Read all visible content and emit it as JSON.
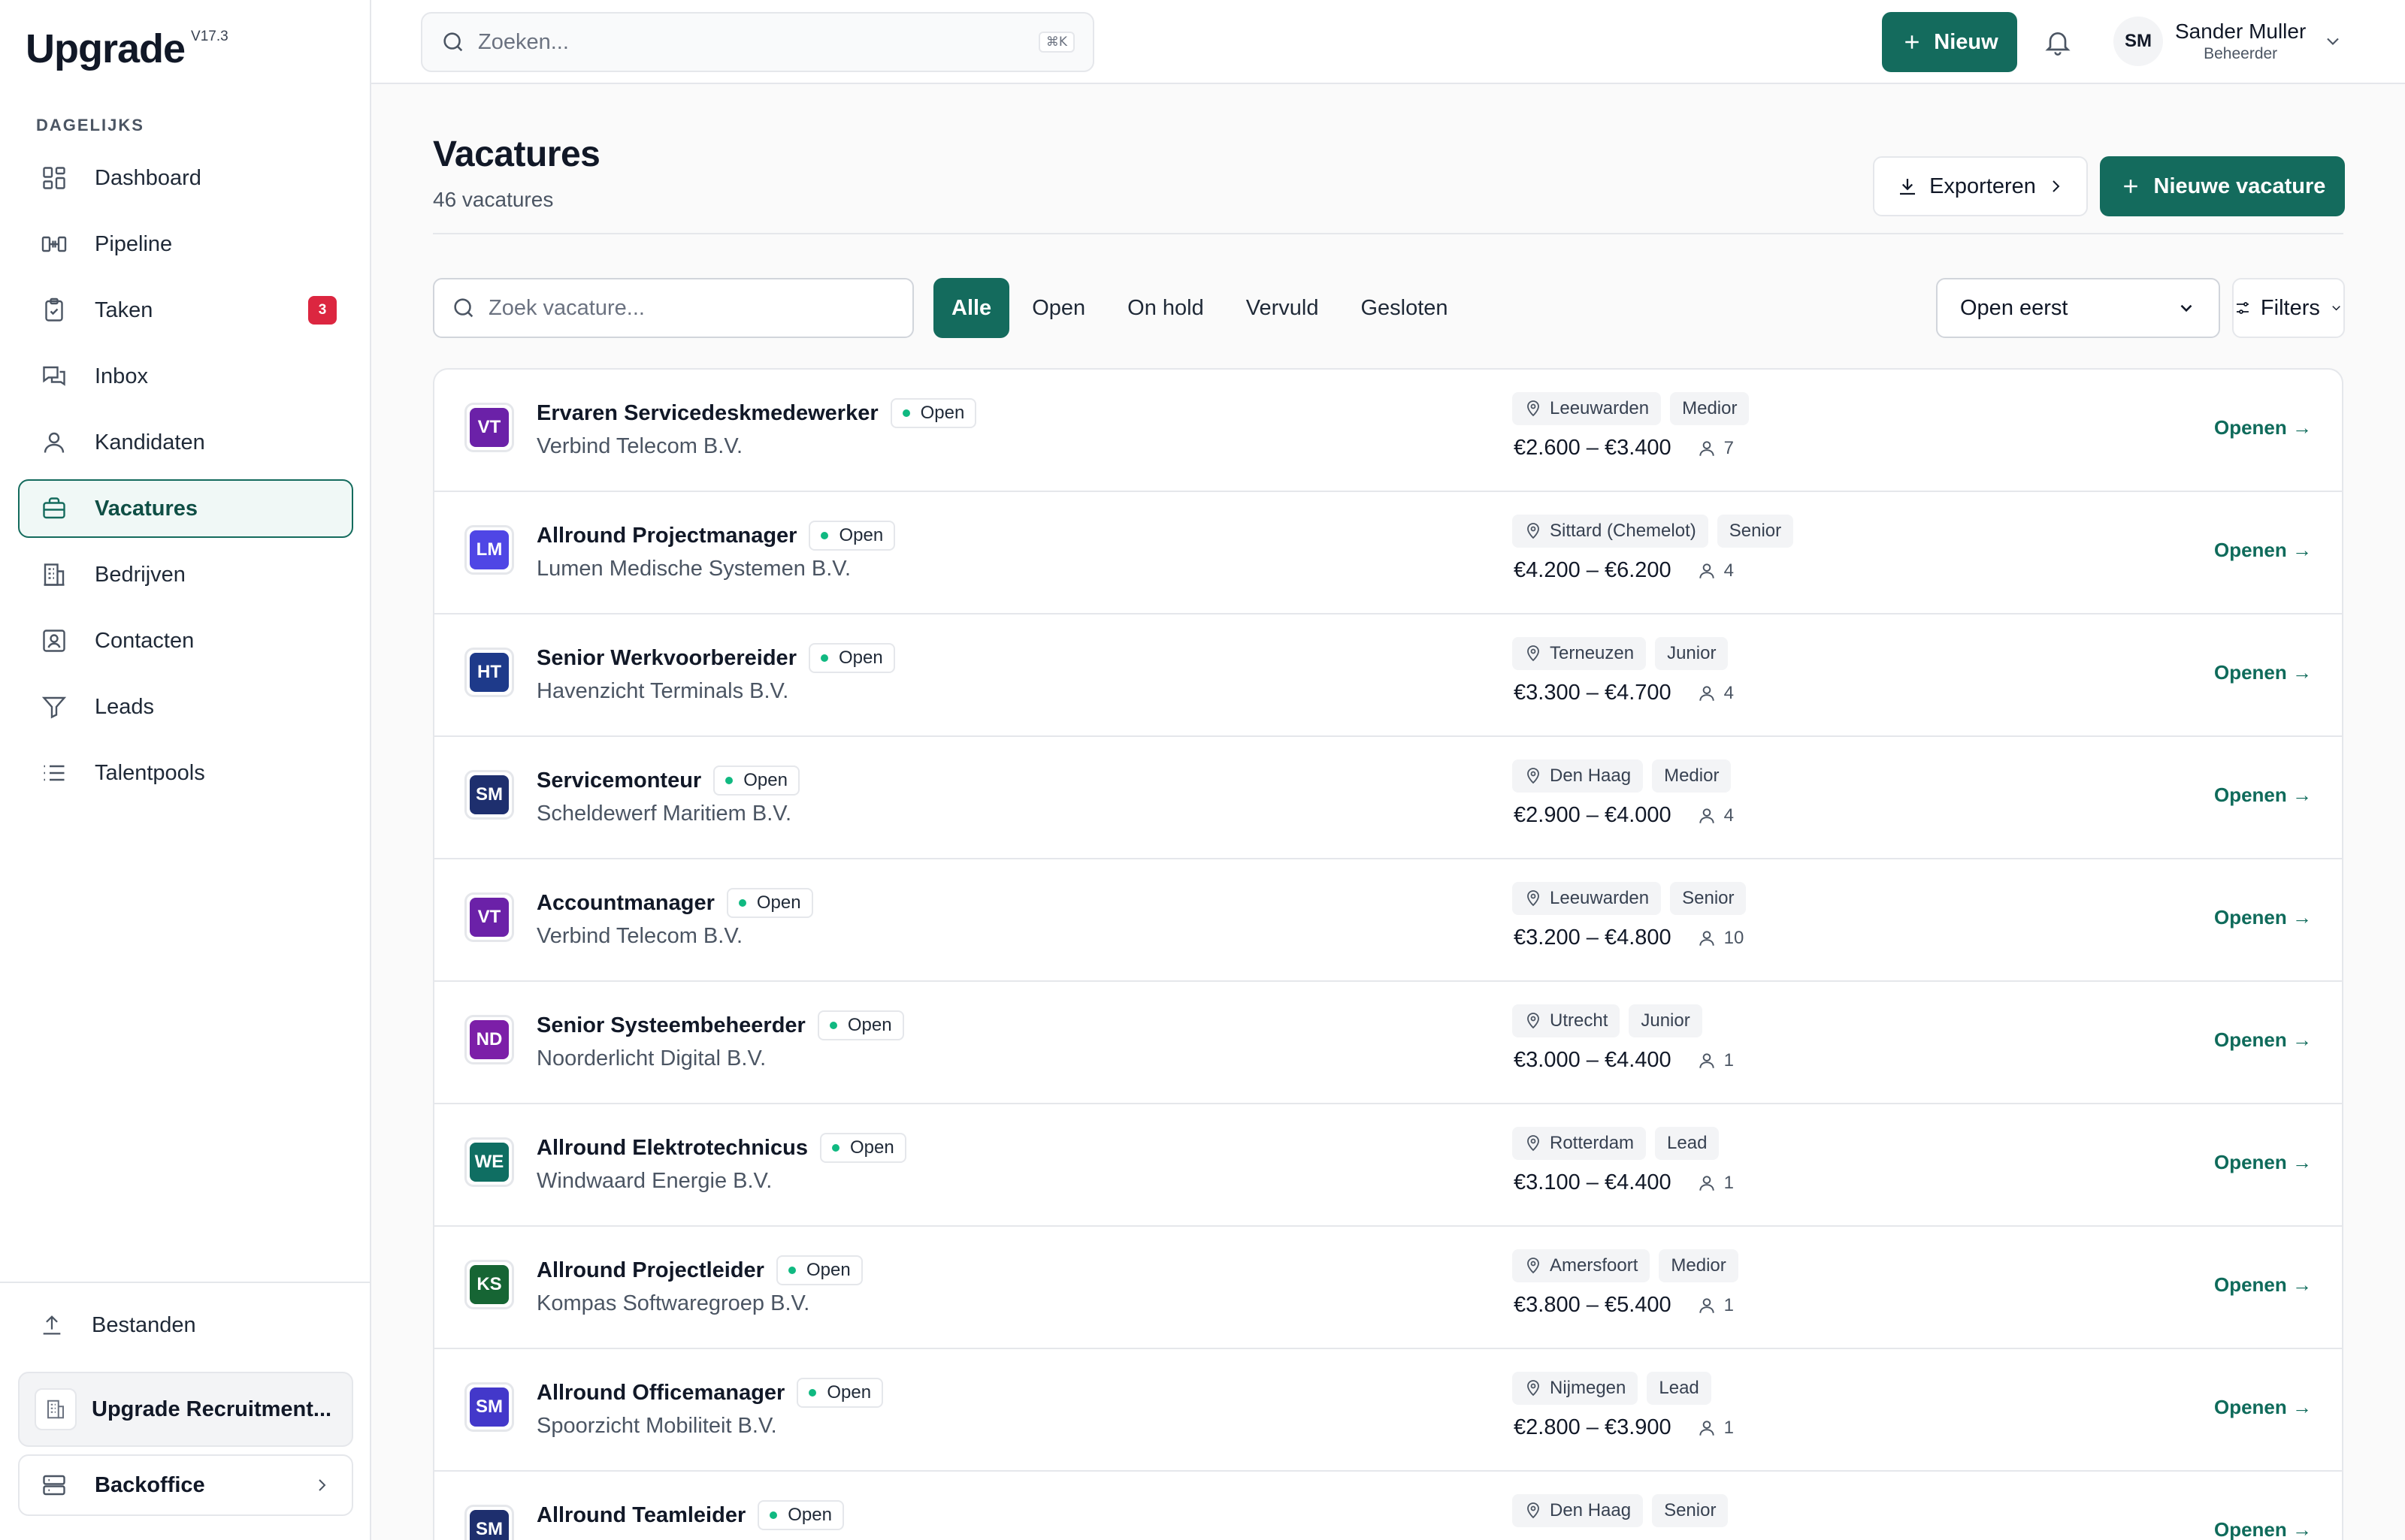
{
  "app": {
    "logo": "Upgrade",
    "version": "V17.3"
  },
  "sidebar": {
    "section_label": "DAGELIJKS",
    "items": [
      {
        "label": "Dashboard",
        "icon": "dashboard-icon"
      },
      {
        "label": "Pipeline",
        "icon": "pipeline-icon"
      },
      {
        "label": "Taken",
        "icon": "clipboard-icon",
        "badge": "3"
      },
      {
        "label": "Inbox",
        "icon": "inbox-icon"
      },
      {
        "label": "Kandidaten",
        "icon": "user-icon"
      },
      {
        "label": "Vacatures",
        "icon": "briefcase-icon",
        "active": true
      },
      {
        "label": "Bedrijven",
        "icon": "building-icon"
      },
      {
        "label": "Contacten",
        "icon": "contact-icon"
      },
      {
        "label": "Leads",
        "icon": "filter-icon"
      },
      {
        "label": "Talentpools",
        "icon": "list-icon"
      }
    ],
    "files_label": "Bestanden",
    "org_label": "Upgrade Recruitment...",
    "backoffice_label": "Backoffice"
  },
  "topbar": {
    "search_placeholder": "Zoeken...",
    "shortcut": "⌘K",
    "new_button": "Nieuw",
    "user": {
      "initials": "SM",
      "name": "Sander Muller",
      "role": "Beheerder"
    }
  },
  "page": {
    "title": "Vacatures",
    "count": "46 vacatures",
    "export_button": "Exporteren",
    "new_vacancy_button": "Nieuwe vacature",
    "search_placeholder": "Zoek vacature...",
    "tabs": [
      "Alle",
      "Open",
      "On hold",
      "Vervuld",
      "Gesloten"
    ],
    "active_tab": "Alle",
    "sort_value": "Open eerst",
    "filters_label": "Filters",
    "open_link": "Openen →"
  },
  "vacancies": [
    {
      "initials": "VT",
      "color": "#6b21a8",
      "title": "Ervaren Servicedeskmedewerker",
      "status": "Open",
      "company": "Verbind Telecom B.V.",
      "location": "Leeuwarden",
      "level": "Medior",
      "salary": "€2.600 – €3.400",
      "candidates": "7"
    },
    {
      "initials": "LM",
      "color": "#4f46e5",
      "title": "Allround Projectmanager",
      "status": "Open",
      "company": "Lumen Medische Systemen B.V.",
      "location": "Sittard (Chemelot)",
      "level": "Senior",
      "salary": "€4.200 – €6.200",
      "candidates": "4"
    },
    {
      "initials": "HT",
      "color": "#1e3a8a",
      "title": "Senior Werkvoorbereider",
      "status": "Open",
      "company": "Havenzicht Terminals B.V.",
      "location": "Terneuzen",
      "level": "Junior",
      "salary": "€3.300 – €4.700",
      "candidates": "4"
    },
    {
      "initials": "SM",
      "color": "#1e2f6e",
      "title": "Servicemonteur",
      "status": "Open",
      "company": "Scheldewerf Maritiem B.V.",
      "location": "Den Haag",
      "level": "Medior",
      "salary": "€2.900 – €4.000",
      "candidates": "4"
    },
    {
      "initials": "VT",
      "color": "#6b21a8",
      "title": "Accountmanager",
      "status": "Open",
      "company": "Verbind Telecom B.V.",
      "location": "Leeuwarden",
      "level": "Senior",
      "salary": "€3.200 – €4.800",
      "candidates": "10"
    },
    {
      "initials": "ND",
      "color": "#7c1fa8",
      "title": "Senior Systeembeheerder",
      "status": "Open",
      "company": "Noorderlicht Digital B.V.",
      "location": "Utrecht",
      "level": "Junior",
      "salary": "€3.000 – €4.400",
      "candidates": "1"
    },
    {
      "initials": "WE",
      "color": "#0f6e62",
      "title": "Allround Elektrotechnicus",
      "status": "Open",
      "company": "Windwaard Energie B.V.",
      "location": "Rotterdam",
      "level": "Lead",
      "salary": "€3.100 – €4.400",
      "candidates": "1"
    },
    {
      "initials": "KS",
      "color": "#166534",
      "title": "Allround Projectleider",
      "status": "Open",
      "company": "Kompas Softwaregroep B.V.",
      "location": "Amersfoort",
      "level": "Medior",
      "salary": "€3.800 – €5.400",
      "candidates": "1"
    },
    {
      "initials": "SM",
      "color": "#4338ca",
      "title": "Allround Officemanager",
      "status": "Open",
      "company": "Spoorzicht Mobiliteit B.V.",
      "location": "Nijmegen",
      "level": "Lead",
      "salary": "€2.800 – €3.900",
      "candidates": "1"
    },
    {
      "initials": "SM",
      "color": "#1e2f6e",
      "title": "Allround Teamleider",
      "status": "Open",
      "company": "",
      "location": "Den Haag",
      "level": "Senior",
      "salary": "",
      "candidates": ""
    }
  ],
  "colors": {
    "accent": "#146b5d",
    "badge": "#dc2640",
    "status_dot": "#10b981"
  }
}
